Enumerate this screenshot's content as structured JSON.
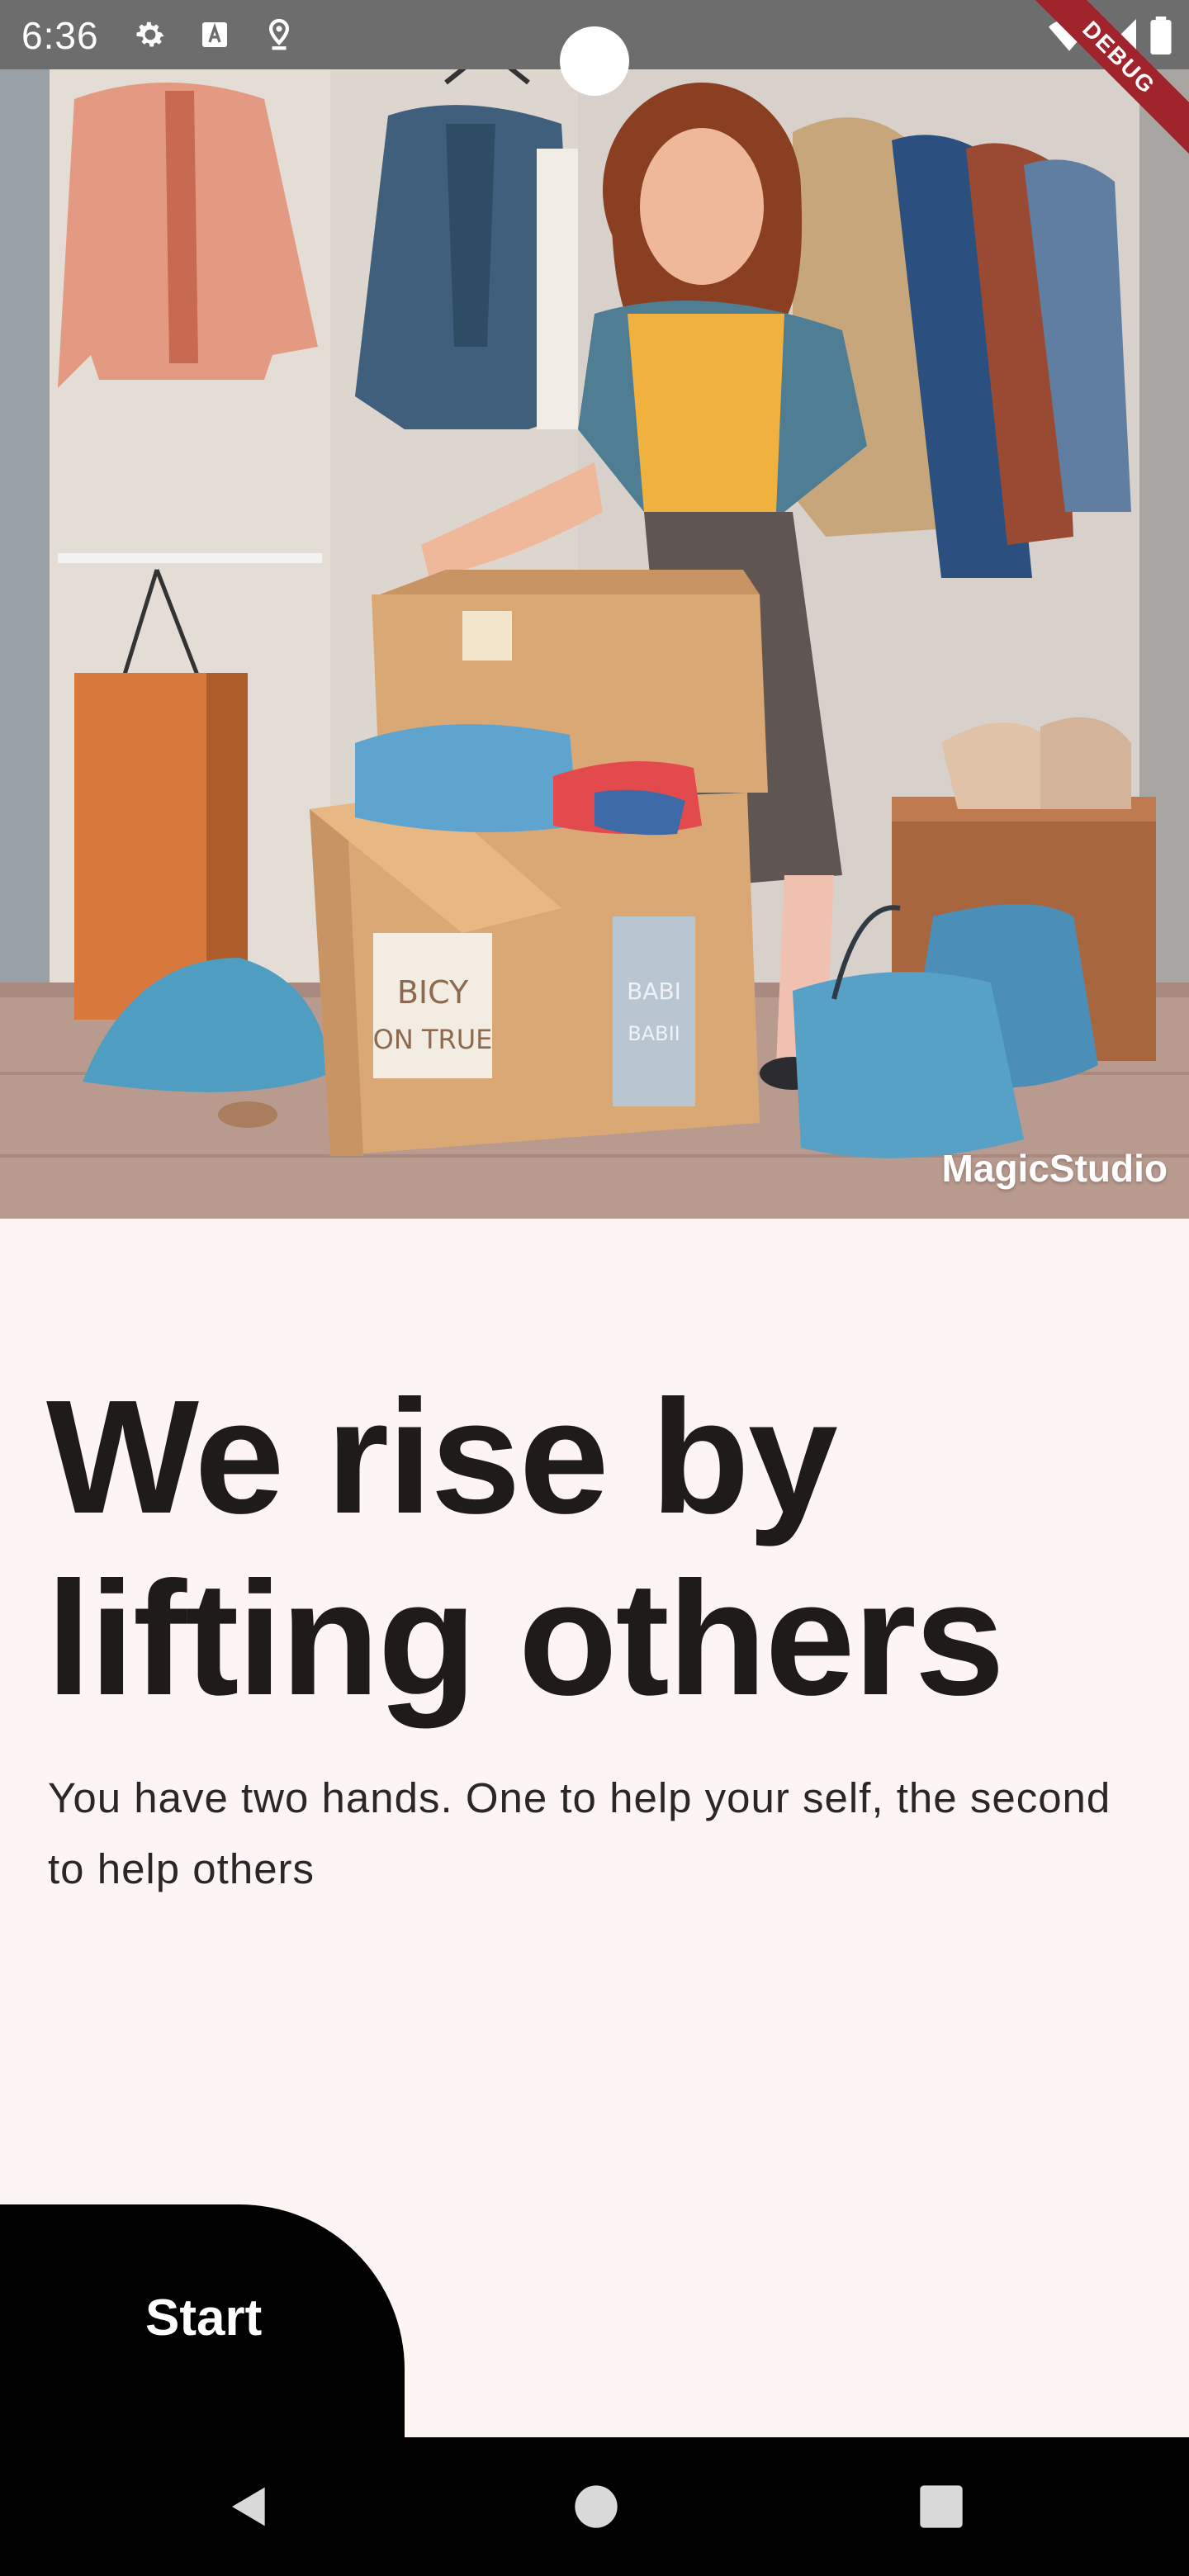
{
  "status_bar": {
    "time": "6:36",
    "left_icons": [
      "settings-icon",
      "font-a-icon",
      "location-pin-icon"
    ],
    "right_icons": [
      "wifi-icon",
      "signal-icon",
      "battery-icon"
    ],
    "debug_label": "DEBUG"
  },
  "hero": {
    "description_icon": "illustration",
    "watermark": "MagicStudio",
    "box_front_label": [
      "BICY",
      "ON TRUE"
    ],
    "box_tag": [
      "BABI",
      "BABII"
    ]
  },
  "content": {
    "headline": "We rise by lifting others",
    "subtitle": "You have two hands. One to help your self, the second to help others"
  },
  "actions": {
    "start_label": "Start"
  },
  "nav_bar": {
    "back_icon": "back-triangle-icon",
    "home_icon": "home-circle-icon",
    "recents_icon": "recents-square-icon"
  },
  "colors": {
    "background": "#fdf5f3",
    "text": "#1f1b1a",
    "button": "#000000",
    "status_bar": "#6d6d6d",
    "debug_ribbon": "#a0242b"
  }
}
